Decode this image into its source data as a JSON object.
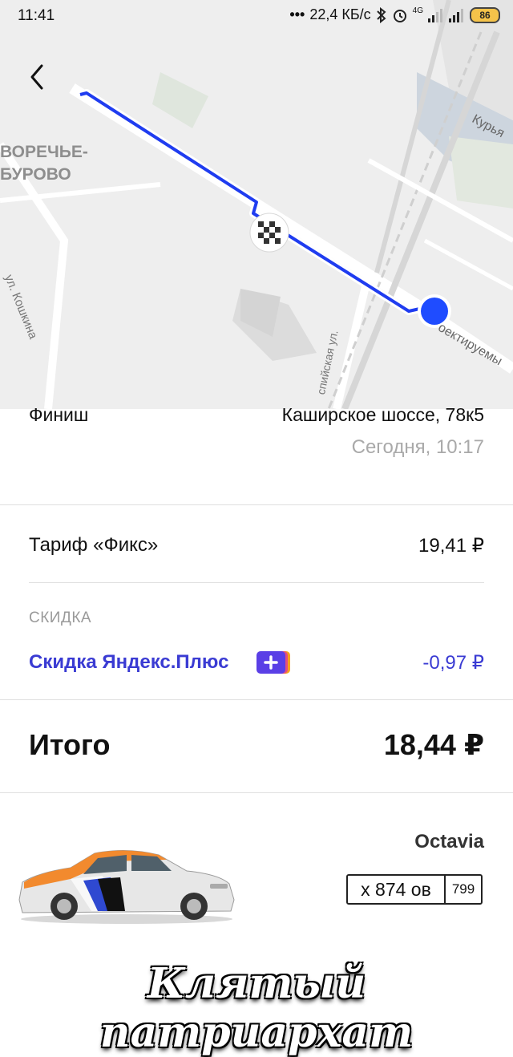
{
  "status_bar": {
    "time": "11:41",
    "network_speed": "22,4 КБ/с",
    "network_type": "4G",
    "battery": "86",
    "icons": [
      "dots-icon",
      "bluetooth-icon",
      "alarm-icon",
      "signal-icon",
      "signal-icon",
      "battery-icon"
    ]
  },
  "map": {
    "labels": {
      "district": "ВОРЕЧЬЕ-",
      "district2": "БУРОВО",
      "street1": "ул. Кошкина",
      "street2": "спийская ул.",
      "street3": "Курья",
      "street4": "оектируемы"
    },
    "route_color": "#1f3cf0",
    "start_marker_color": "#1f4cff"
  },
  "trip": {
    "finish_label": "Финиш",
    "finish_address": "Каширское шоссе, 78к5",
    "finish_time": "Сегодня, 10:17"
  },
  "pricing": {
    "tariff_label": "Тариф «Фикс»",
    "tariff_price": "19,41 ₽",
    "discount_header": "СКИДКА",
    "discount_label": "Скидка Яндекс.Плюс",
    "discount_value": "-0,97 ₽",
    "total_label": "Итого",
    "total_value": "18,44 ₽",
    "accent_color": "#3a3bd3"
  },
  "car": {
    "model": "Octavia",
    "plate": "х 874 ов",
    "region": "799"
  },
  "watermark": "Клятый патриархат"
}
